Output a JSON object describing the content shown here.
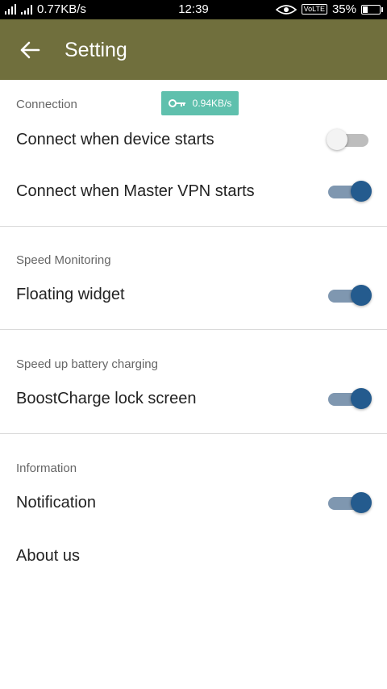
{
  "status_bar": {
    "speed": "0.77KB/s",
    "time": "12:39",
    "volte": "VoLTE",
    "battery": "35%",
    "battery_level": 0.35
  },
  "appbar": {
    "title": "Setting",
    "back_icon": "arrow-left-icon"
  },
  "colors": {
    "appbar": "#706f3d",
    "toggle_on_thumb": "#245b8e",
    "toggle_on_track": "#7f97b0",
    "badge": "#5fc0ad"
  },
  "connection": {
    "header": "Connection",
    "speed_badge": "0.94KB/s",
    "speed_badge_icon": "key-icon",
    "items": [
      {
        "label": "Connect when device starts",
        "enabled": false
      },
      {
        "label": "Connect when Master VPN starts",
        "enabled": true
      }
    ]
  },
  "speed_monitoring": {
    "header": "Speed Monitoring",
    "items": [
      {
        "label": "Floating widget",
        "enabled": true
      }
    ]
  },
  "battery_charging": {
    "header": "Speed up battery charging",
    "items": [
      {
        "label": "BoostCharge lock screen",
        "enabled": true
      }
    ]
  },
  "information": {
    "header": "Information",
    "items": [
      {
        "label": "Notification",
        "enabled": true
      },
      {
        "label": "About us"
      }
    ]
  }
}
